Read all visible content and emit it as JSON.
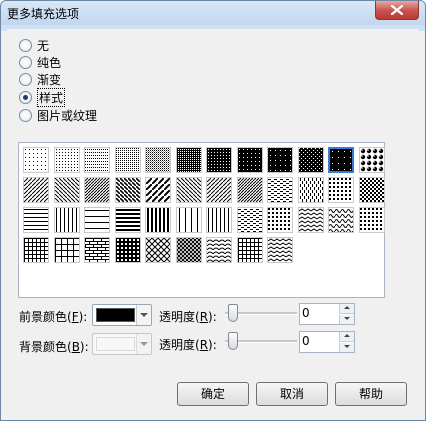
{
  "window": {
    "title": "更多填充选项"
  },
  "fill_options": [
    {
      "label": "无",
      "checked": false
    },
    {
      "label": "纯色",
      "checked": false
    },
    {
      "label": "渐变",
      "checked": false
    },
    {
      "label": "样式",
      "checked": true
    },
    {
      "label": "图片或纹理",
      "checked": false
    }
  ],
  "patterns": {
    "count": 45,
    "columns": 12,
    "selected_index": 10
  },
  "foreground": {
    "label": "前景颜色(",
    "key": "F",
    "suffix": "):",
    "color": "#000000"
  },
  "background": {
    "label": "背景颜色(",
    "key": "B",
    "suffix": "):",
    "color": "#ffffff"
  },
  "transparency_fg": {
    "label": "透明度(",
    "key": "R",
    "suffix": "):",
    "value": "0",
    "level": 0
  },
  "transparency_bg": {
    "label": "透明度(",
    "key": "R",
    "suffix": "):",
    "value": "0",
    "level": 0
  },
  "buttons": {
    "ok": "确定",
    "cancel": "取消",
    "help": "帮助"
  },
  "colors": {
    "title_bar": "#cfe0f3",
    "selection": "#3b7ad8",
    "close": "#c75050"
  },
  "icons": {
    "close": "close-icon"
  }
}
